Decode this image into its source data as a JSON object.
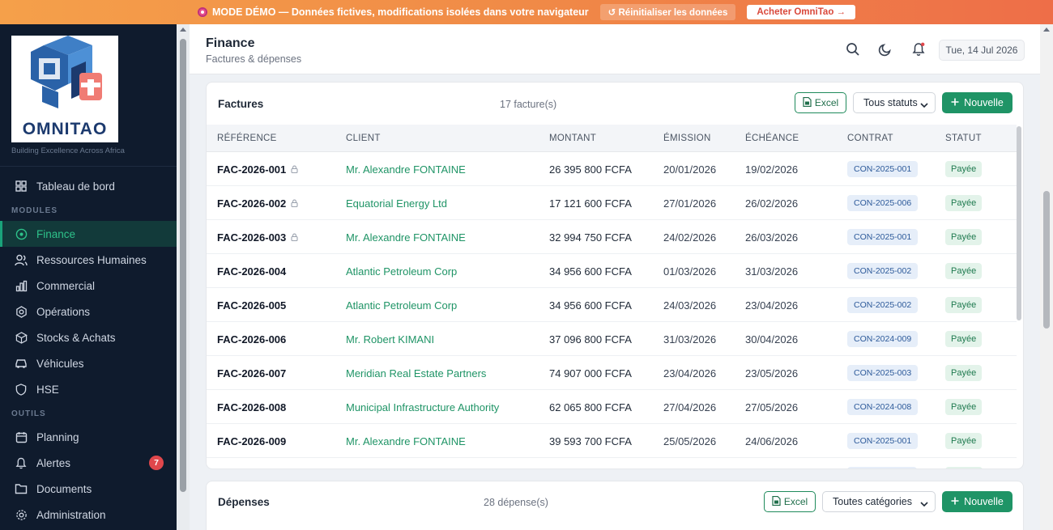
{
  "banner": {
    "text": "MODE DÉMO — Données fictives, modifications isolées dans votre navigateur",
    "reset_label": "↺ Réinitialiser les données",
    "buy_label": "Acheter OmniTao →"
  },
  "brand": {
    "name": "OMNITAO",
    "tagline": "Building Excellence Across Africa",
    "colors": {
      "blue": "#2a62a8",
      "coral": "#f07c74",
      "navy": "#1c3a6e"
    }
  },
  "sidebar": {
    "dashboard": "Tableau de bord",
    "section_modules": "MODULES",
    "modules": [
      {
        "label": "Finance",
        "icon": "finance-icon",
        "active": true
      },
      {
        "label": "Ressources Humaines",
        "icon": "people-icon"
      },
      {
        "label": "Commercial",
        "icon": "bar-chart-icon"
      },
      {
        "label": "Opérations",
        "icon": "operations-icon"
      },
      {
        "label": "Stocks & Achats",
        "icon": "box-icon"
      },
      {
        "label": "Véhicules",
        "icon": "car-icon"
      },
      {
        "label": "HSE",
        "icon": "shield-icon"
      }
    ],
    "section_tools": "OUTILS",
    "tools": [
      {
        "label": "Planning",
        "icon": "calendar-icon"
      },
      {
        "label": "Alertes",
        "icon": "bell-icon",
        "badge": "7"
      },
      {
        "label": "Documents",
        "icon": "folder-icon"
      },
      {
        "label": "Administration",
        "icon": "settings-icon"
      }
    ]
  },
  "header": {
    "title": "Finance",
    "subtitle": "Factures & dépenses",
    "date": "Tue, 14 Jul 2026"
  },
  "invoices": {
    "title": "Factures",
    "count": "17 facture(s)",
    "excel_label": "Excel",
    "filter_value": "Tous statuts",
    "new_label": "Nouvelle",
    "columns": [
      "RÉFÉRENCE",
      "CLIENT",
      "MONTANT",
      "ÉMISSION",
      "ÉCHÉANCE",
      "CONTRAT",
      "STATUT"
    ],
    "rows": [
      {
        "ref": "FAC-2026-001",
        "locked": true,
        "client": "Mr. Alexandre FONTAINE",
        "amount": "26 395 800 FCFA",
        "issued": "20/01/2026",
        "due": "19/02/2026",
        "contract": "CON-2025-001",
        "status": "Payée"
      },
      {
        "ref": "FAC-2026-002",
        "locked": true,
        "client": "Equatorial Energy Ltd",
        "amount": "17 121 600 FCFA",
        "issued": "27/01/2026",
        "due": "26/02/2026",
        "contract": "CON-2025-006",
        "status": "Payée"
      },
      {
        "ref": "FAC-2026-003",
        "locked": true,
        "client": "Mr. Alexandre FONTAINE",
        "amount": "32 994 750 FCFA",
        "issued": "24/02/2026",
        "due": "26/03/2026",
        "contract": "CON-2025-001",
        "status": "Payée"
      },
      {
        "ref": "FAC-2026-004",
        "locked": false,
        "client": "Atlantic Petroleum Corp",
        "amount": "34 956 600 FCFA",
        "issued": "01/03/2026",
        "due": "31/03/2026",
        "contract": "CON-2025-002",
        "status": "Payée"
      },
      {
        "ref": "FAC-2026-005",
        "locked": false,
        "client": "Atlantic Petroleum Corp",
        "amount": "34 956 600 FCFA",
        "issued": "24/03/2026",
        "due": "23/04/2026",
        "contract": "CON-2025-002",
        "status": "Payée"
      },
      {
        "ref": "FAC-2026-006",
        "locked": false,
        "client": "Mr. Robert KIMANI",
        "amount": "37 096 800 FCFA",
        "issued": "31/03/2026",
        "due": "30/04/2026",
        "contract": "CON-2024-009",
        "status": "Payée"
      },
      {
        "ref": "FAC-2026-007",
        "locked": false,
        "client": "Meridian Real Estate Partners",
        "amount": "74 907 000 FCFA",
        "issued": "23/04/2026",
        "due": "23/05/2026",
        "contract": "CON-2025-003",
        "status": "Payée"
      },
      {
        "ref": "FAC-2026-008",
        "locked": false,
        "client": "Municipal Infrastructure Authority",
        "amount": "62 065 800 FCFA",
        "issued": "27/04/2026",
        "due": "27/05/2026",
        "contract": "CON-2024-008",
        "status": "Payée"
      },
      {
        "ref": "FAC-2026-009",
        "locked": false,
        "client": "Mr. Alexandre FONTAINE",
        "amount": "39 593 700 FCFA",
        "issued": "25/05/2026",
        "due": "24/06/2026",
        "contract": "CON-2025-001",
        "status": "Payée"
      }
    ]
  },
  "expenses": {
    "title": "Dépenses",
    "count": "28 dépense(s)",
    "excel_label": "Excel",
    "filter_value": "Toutes catégories",
    "new_label": "Nouvelle"
  }
}
